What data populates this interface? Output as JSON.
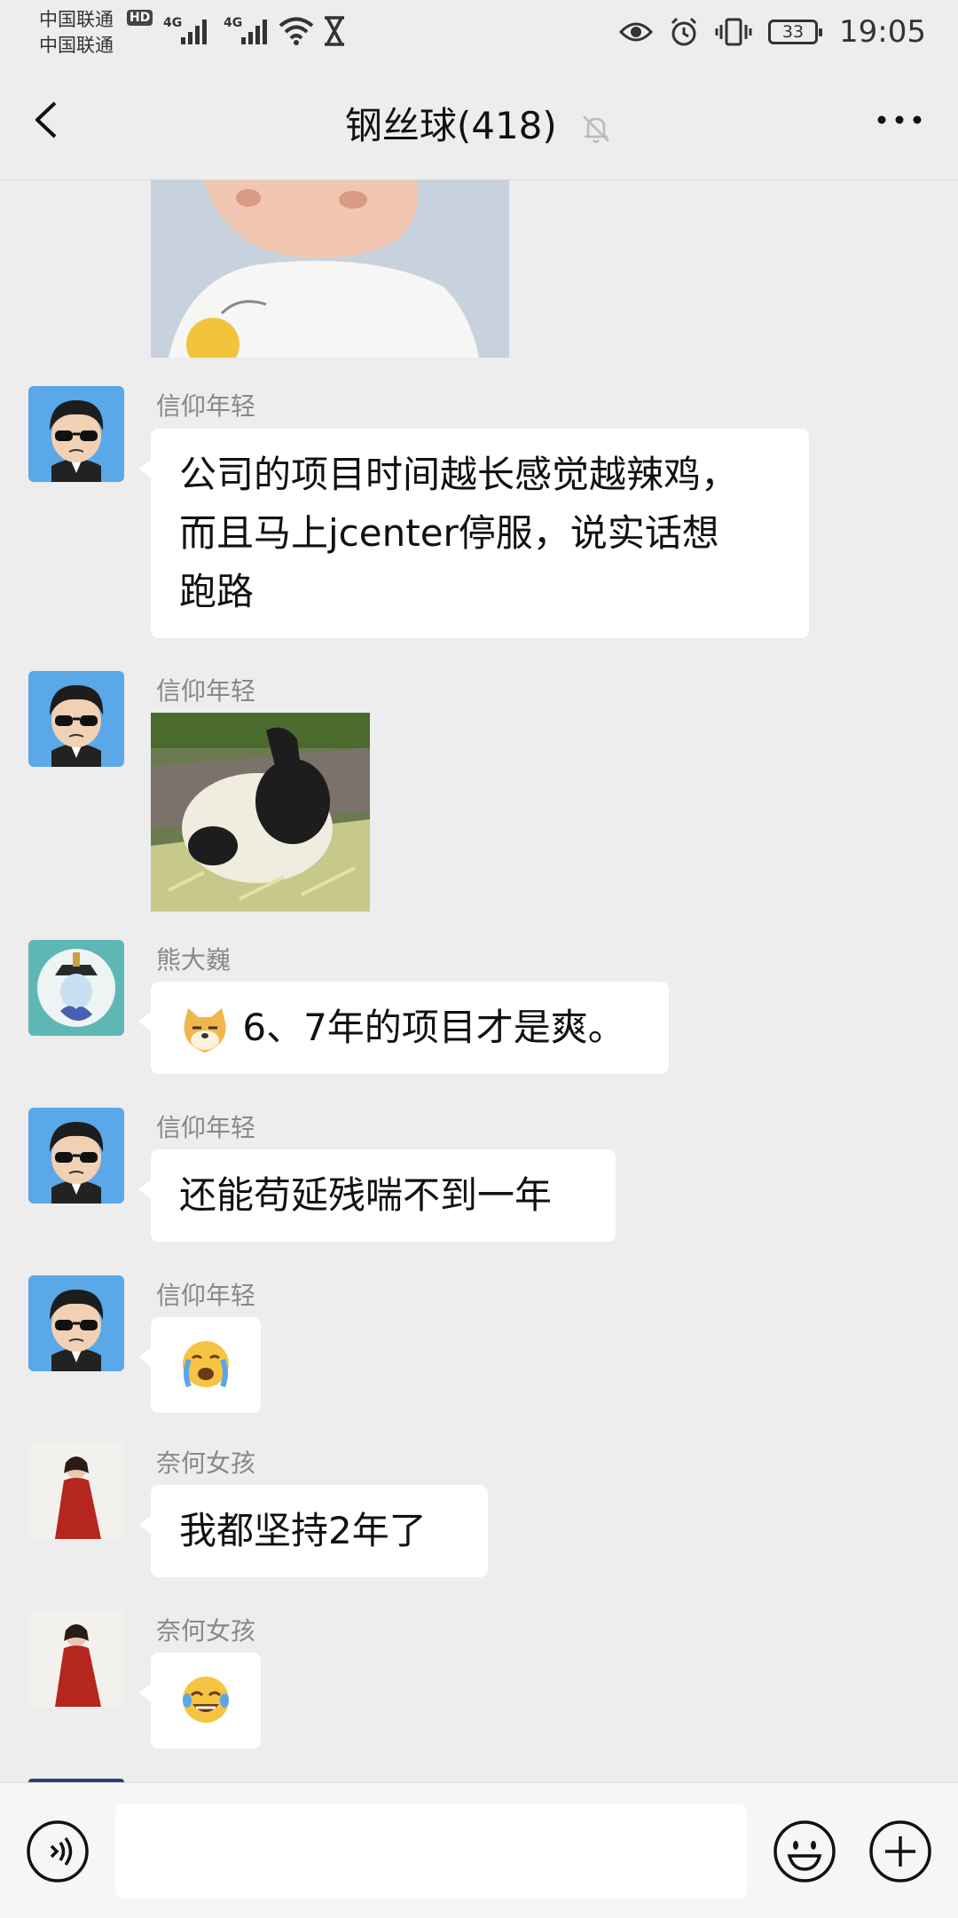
{
  "status_bar": {
    "carrier_1": "中国联通",
    "carrier_2": "中国联通",
    "hd_badge": "HD",
    "network_1": "4G",
    "network_2": "4G",
    "battery": "33",
    "time": "19:05"
  },
  "header": {
    "title": "钢丝球(418)"
  },
  "messages": [
    {
      "sender": "信仰年轻",
      "type": "text",
      "text_lines": [
        "公司的项目时间越长感觉越辣鸡，",
        "而且马上jcenter停服，说实话想",
        "跑路"
      ]
    },
    {
      "sender": "信仰年轻",
      "type": "image"
    },
    {
      "sender": "熊大巍",
      "type": "text",
      "text": "6、7年的项目才是爽。",
      "leading_emoji": "doge-face-icon"
    },
    {
      "sender": "信仰年轻",
      "type": "text",
      "text": "还能苟延残喘不到一年"
    },
    {
      "sender": "信仰年轻",
      "type": "emoji",
      "emoji": "loudly-crying-face-icon"
    },
    {
      "sender": "奈何女孩",
      "type": "text",
      "text": "我都坚持2年了"
    },
    {
      "sender": "奈何女孩",
      "type": "emoji",
      "emoji": "tears-of-joy-icon"
    }
  ],
  "input_bar": {
    "text_value": "",
    "icons": [
      "voice-icon",
      "emoji-icon",
      "plus-icon"
    ]
  },
  "colors": {
    "background": "#ededed",
    "bubble": "#ffffff",
    "sender_name": "#888888"
  }
}
